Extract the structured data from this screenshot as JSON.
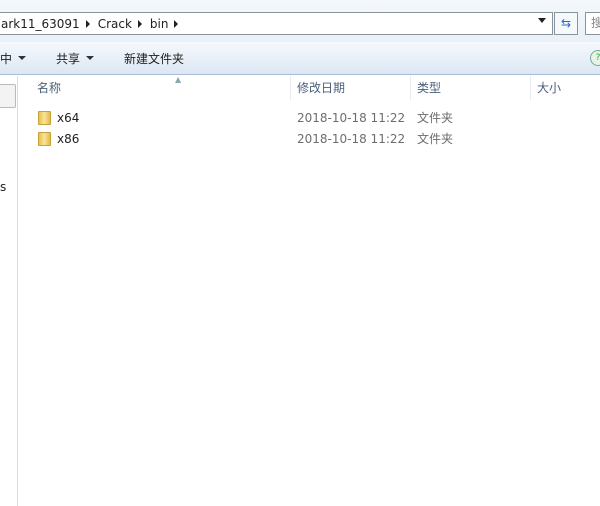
{
  "address_bar": {
    "crumbs": [
      "ark11_63091",
      "Crack",
      "bin"
    ]
  },
  "search": {
    "placeholder_partial": "搜"
  },
  "toolbar": {
    "organize_partial": "中",
    "share": "共享",
    "new_folder": "新建文件夹"
  },
  "nav": {
    "partial_text": "s"
  },
  "columns": {
    "name": "名称",
    "date": "修改日期",
    "type": "类型",
    "size": "大小"
  },
  "files": [
    {
      "name": "x64",
      "date": "2018-10-18 11:22",
      "type": "文件夹",
      "icon": "folder-icon"
    },
    {
      "name": "x86",
      "date": "2018-10-18 11:22",
      "type": "文件夹",
      "icon": "folder-icon"
    }
  ]
}
